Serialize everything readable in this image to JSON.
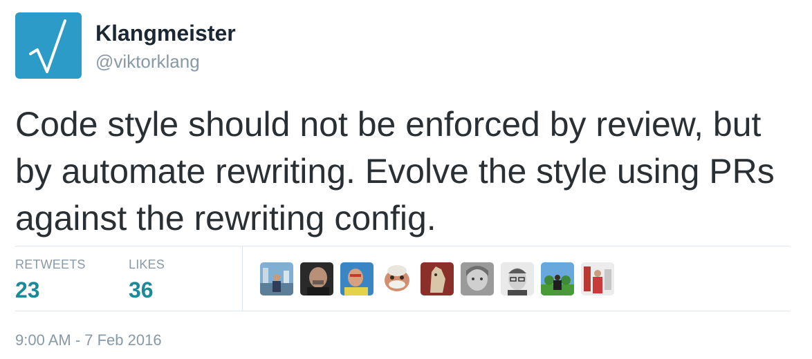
{
  "author": {
    "display_name": "Klangmeister",
    "handle": "@viktorklang",
    "avatar_icon": "square-root-logo-icon",
    "avatar_color": "#2d9bc7"
  },
  "tweet": {
    "text": "Code style should not be enforced by review, but by automate rewriting. Evolve the style using PRs against the rewriting config.",
    "timestamp": "9:00 AM - 7 Feb 2016"
  },
  "stats": {
    "retweets_label": "RETWEETS",
    "retweets_value": "23",
    "likes_label": "LIKES",
    "likes_value": "36"
  },
  "likers_count_shown": 9,
  "colors": {
    "stat_value": "#1b8a99",
    "muted": "#8899a6",
    "text": "#292f33"
  }
}
